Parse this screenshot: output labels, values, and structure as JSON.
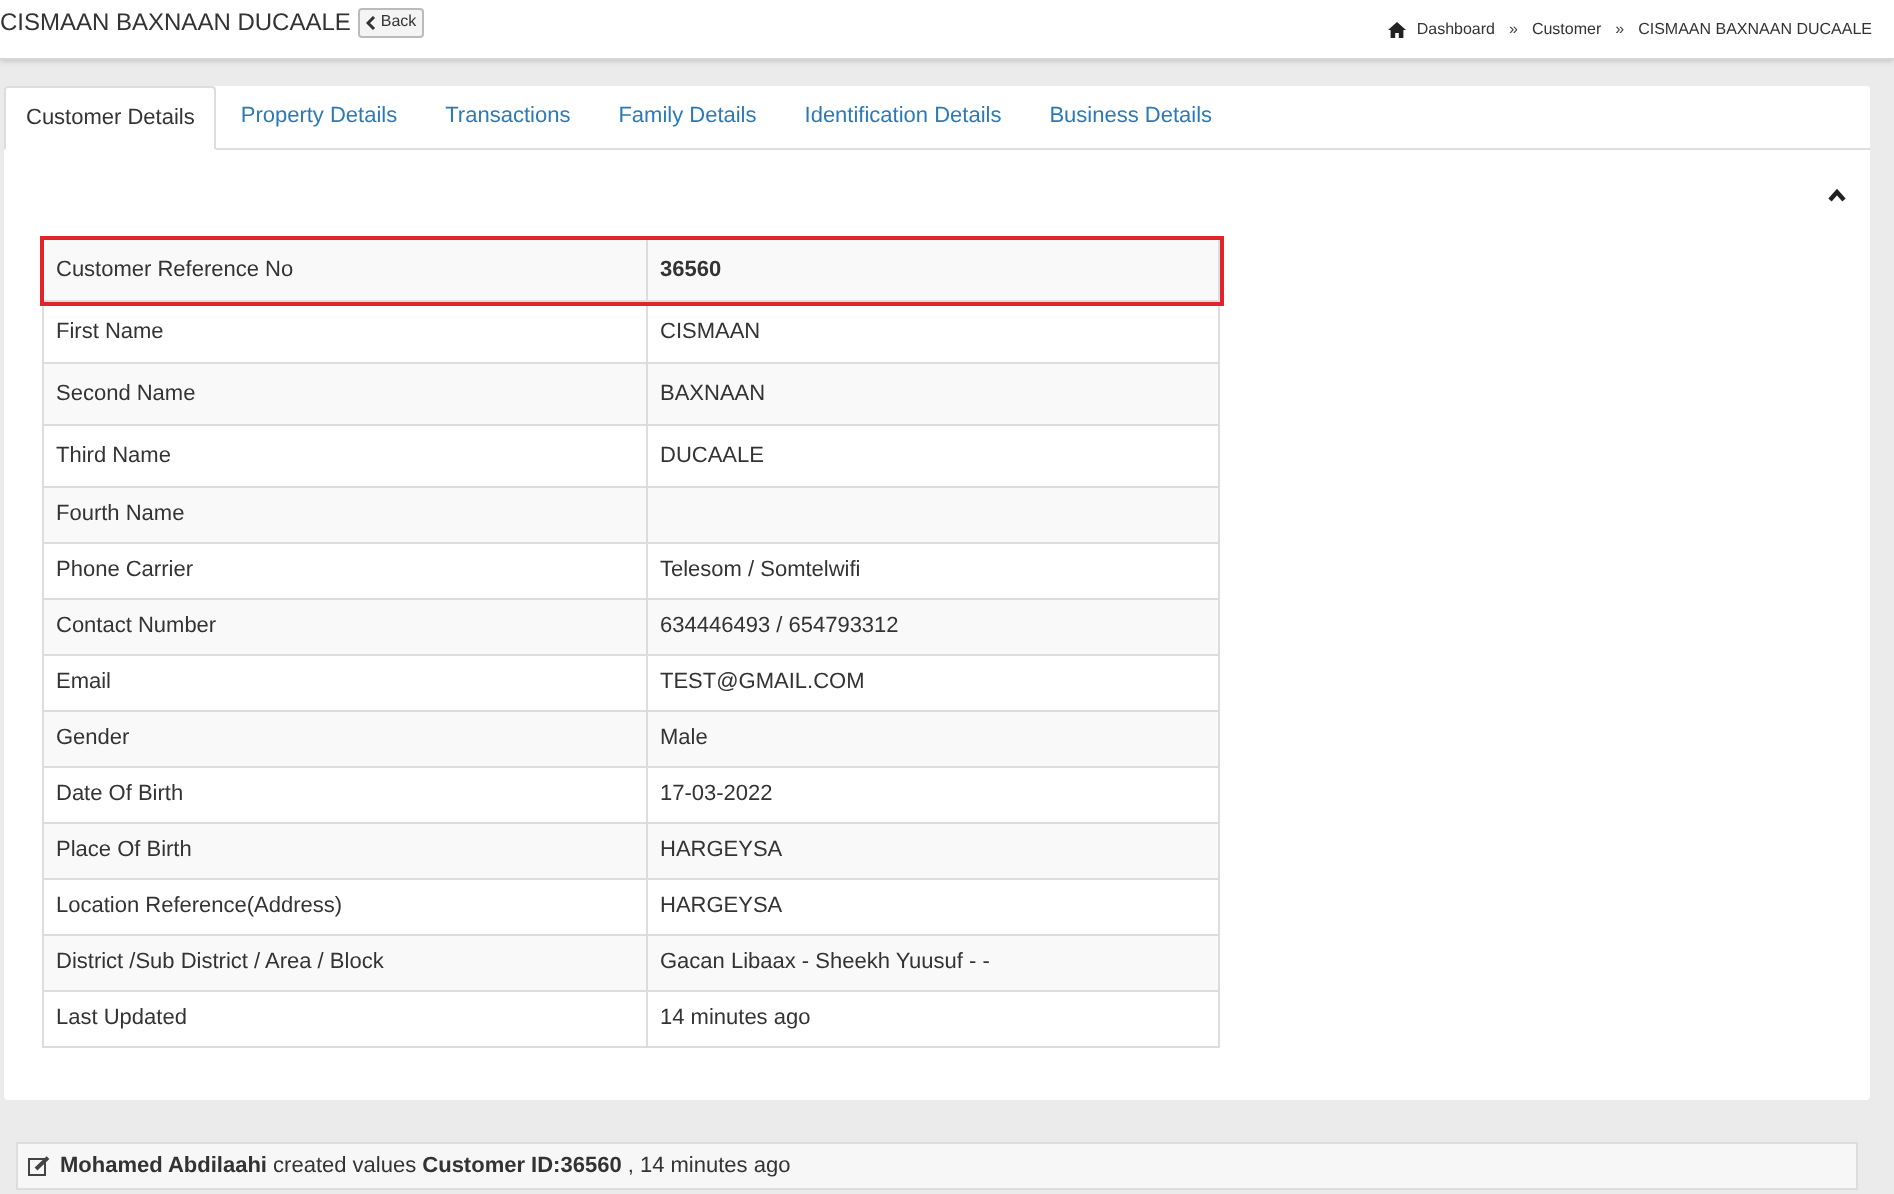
{
  "page_title": "CISMAAN BAXNAAN DUCAALE",
  "back_button": "Back",
  "breadcrumb": [
    "Dashboard",
    "Customer",
    "CISMAAN BAXNAAN DUCAALE"
  ],
  "breadcrumb_separator": "»",
  "tabs": [
    {
      "label": "Customer Details",
      "selected": true
    },
    {
      "label": "Property Details",
      "selected": false
    },
    {
      "label": "Transactions",
      "selected": false
    },
    {
      "label": "Family Details",
      "selected": false
    },
    {
      "label": "Identification Details",
      "selected": false
    },
    {
      "label": "Business Details",
      "selected": false
    }
  ],
  "details": [
    {
      "label": "Customer Reference No",
      "value": "36560",
      "highlighted": true
    },
    {
      "label": "First Name",
      "value": "CISMAAN",
      "highlighted": false
    },
    {
      "label": "Second Name",
      "value": "BAXNAAN",
      "highlighted": false
    },
    {
      "label": "Third Name",
      "value": "DUCAALE",
      "highlighted": false
    },
    {
      "label": "Fourth Name",
      "highlighted": false
    },
    {
      "label": "Phone Carrier",
      "value": "Telesom / Somtelwifi",
      "highlighted": false
    },
    {
      "label": "Contact Number",
      "value": "634446493 / 654793312",
      "highlighted": false
    },
    {
      "label": "Email",
      "value": "TEST@GMAIL.COM",
      "highlighted": false
    },
    {
      "label": "Gender",
      "value": "Male",
      "highlighted": false
    },
    {
      "label": "Date Of Birth",
      "value": "17-03-2022",
      "highlighted": false
    },
    {
      "label": "Place Of Birth",
      "value": "HARGEYSA",
      "highlighted": false
    },
    {
      "label": "Location Reference(Address)",
      "value": "HARGEYSA",
      "highlighted": false
    },
    {
      "label": "District /Sub District / Area / Block",
      "value": "Gacan Libaax - Sheekh Yuusuf - -",
      "highlighted": false
    },
    {
      "label": "Last Updated",
      "value": "14 minutes ago",
      "highlighted": false
    }
  ],
  "activity": "**Mohamed Abdilaahi** created values **Customer ID:36560** , 14 minutes ago"
}
